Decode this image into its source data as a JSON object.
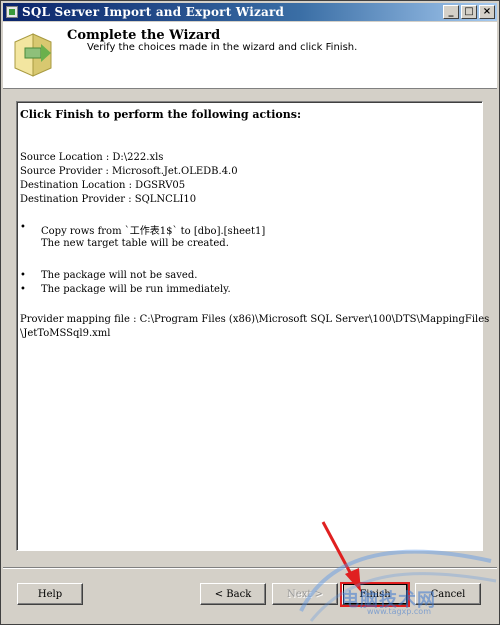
{
  "window": {
    "title": "SQL Server Import and Export Wizard",
    "controls": {
      "minimize": "_",
      "maximize": "□",
      "close": "×"
    }
  },
  "header": {
    "title": "Complete the Wizard",
    "subtitle": "Verify the choices made in the wizard and click Finish."
  },
  "summary": {
    "headline": "Click Finish to perform the following actions:",
    "source_location": "Source Location : D:\\222.xls",
    "source_provider": "Source Provider : Microsoft.Jet.OLEDB.4.0",
    "destination_location": "Destination Location : DGSRV05",
    "destination_provider": "Destination Provider : SQLNCLI10",
    "bullet_symbol": "•",
    "copy_rows": "Copy rows from `工作表1$` to [dbo].[sheet1]",
    "copy_rows_note": "The new target table will be created.",
    "package_not_saved": "The package will not be saved.",
    "package_run": "The package will be run immediately.",
    "mapping_file_line1": "Provider mapping file : C:\\Program Files (x86)\\Microsoft SQL Server\\100\\DTS\\MappingFiles",
    "mapping_file_line2": "\\JetToMSSql9.xml"
  },
  "buttons": {
    "help": "Help",
    "back": "< Back",
    "next": "Next >",
    "finish": "Finish",
    "cancel": "Cancel"
  },
  "watermark": {
    "text": "电脑技术网",
    "sub": "www.tagxp.com"
  },
  "colors": {
    "highlight": "#e02020",
    "titlebar": "#0a246a",
    "dialog": "#d4d0c8"
  }
}
